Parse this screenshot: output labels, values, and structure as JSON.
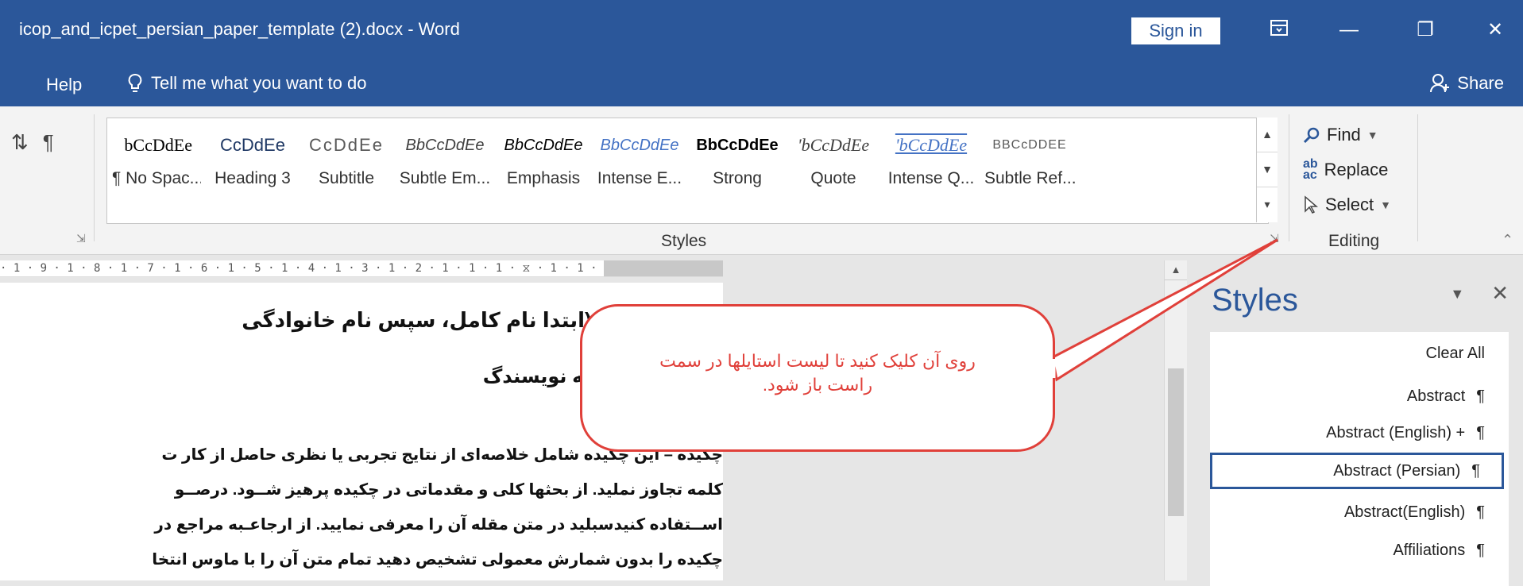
{
  "window": {
    "title": "icop_and_icpet_persian_paper_template (2).docx  -  Word",
    "sign_in": "Sign in",
    "icons": [
      "ribbon-display-icon",
      "minimize-icon",
      "restore-icon",
      "close-icon"
    ]
  },
  "menubar": {
    "help": "Help",
    "tell_me": "Tell me what you want to do",
    "share": "Share"
  },
  "ribbon": {
    "styles_group_label": "Styles",
    "editing_group_label": "Editing",
    "gallery": [
      {
        "preview": " bCcDdEe",
        "label": "¶ No Spac..."
      },
      {
        "preview": "​CcDdEe",
        "label": "Heading 3"
      },
      {
        "preview": "CcDdEe",
        "label": "Subtitle"
      },
      {
        "preview": "BbCcDdEe",
        "label": "Subtle Em..."
      },
      {
        "preview": "BbCcDdEe",
        "label": "Emphasis"
      },
      {
        "preview": "BbCcDdEe",
        "label": "Intense E..."
      },
      {
        "preview": "BbCcDdEe",
        "label": "Strong"
      },
      {
        "preview": "'bCcDdEe",
        "label": "Quote"
      },
      {
        "preview": "'bCcDdEe",
        "label": "Intense Q..."
      },
      {
        "preview": "BBCcDDEE",
        "label": "Subtle Ref..."
      }
    ],
    "editing": {
      "find": "Find",
      "replace": "Replace",
      "select": "Select"
    }
  },
  "ruler": "· 1 · 9 · 1 · 8 · 1 · 7 · 1 · 6 · 1 · 5 · 1 · 4 · 1 · 3 · 1 · 2 · 1 · 1 · 1 · ⧖ · 1 · 1 · 1 ·",
  "document": {
    "author_line": "نویسنده اول (ابتدا نام کامل، سپس نام خانوادگی",
    "address_line": "آدرس و رایا نامه نویسندگ",
    "abstract_lines": [
      "چکیده – این چکیده شامل خلاصه‌ای از نتایج تجربی یا نظری حاصل از کار ت",
      "کلمه تجاوز نملید. از بحثها کلی و مقدماتی در چکیده پرهیز شــود. درصــو",
      "اســتفاده کنیدسبلید در متن مقله آن را معرفی نمایید. از ارجاعـبه مراجع در",
      "چکیده را بدون شمارش معمولی تشخیص دهید تمام متن آن را با ماوس انتخا"
    ]
  },
  "callout": {
    "line1": "روی آن کلیک کنید تا لیست استایلها در سمت",
    "line2": "راست باز شود.",
    "color": "#e0403a"
  },
  "styles_pane": {
    "title": "Styles",
    "items": [
      "Clear All",
      "Abstract",
      "Abstract (English) +",
      "Abstract (Persian)",
      "Abstract(English)",
      "Affiliations"
    ],
    "selected": "Abstract (Persian)"
  },
  "colors": {
    "word_blue": "#2b579a"
  }
}
